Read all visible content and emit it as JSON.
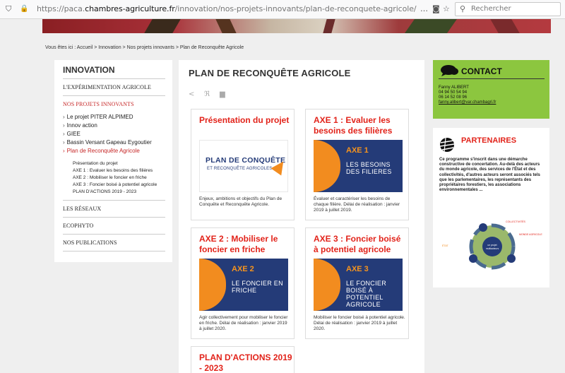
{
  "browser": {
    "url_prefix": "https://paca.",
    "url_domain": "chambres-agriculture.fr",
    "url_path": "/innovation/nos-projets-innovants/plan-de-reconquete-agricole/",
    "menu_icon": "…",
    "search_placeholder": "Rechercher"
  },
  "breadcrumb": "Vous êtes ici : Accueil > Innovation > Nos projets innovants > Plan de Reconquête Agricole",
  "sidebar": {
    "title": "INNOVATION",
    "item_experimentation": "L'EXPÉRIMENTATION AGRICOLE",
    "item_projets": "NOS PROJETS INNOVANTS",
    "sub": [
      "Le projet PITER ALPIMED",
      "Innov action",
      "GIEE",
      "Bassin Versant Gapeau Eygoutier",
      "Plan de Reconquête Agricole"
    ],
    "subsub": [
      "Présentation du projet",
      "AXE 1 : Evaluer les besoins des filières",
      "AXE 2 : Mobiliser le foncier en friche",
      "AXE 3 : Foncier boisé à potentiel agricole",
      "PLAN D'ACTIONS 2019 - 2023"
    ],
    "item_reseaux": "LES RÉSEAUX",
    "item_ecophyto": "ECOPHYTO",
    "item_publications": "NOS PUBLICATIONS"
  },
  "main": {
    "title": "PLAN DE RECONQUÊTE AGRICOLE",
    "cards": [
      {
        "title": "Présentation du projet",
        "img_l1": "PLAN DE CONQUÊTE",
        "img_l2": "ET RECONQUÊTE AGRICOLES",
        "desc": "Enjeux, ambitions et objectifs du Plan de Conquête et Reconquête Agricole."
      },
      {
        "title": "AXE 1 : Evaluer les besoins des filières",
        "img_axe": "AXE 1",
        "img_sub": "LES BESOINS DES FILIERES",
        "desc": "Évaluer et caractériser les besoins de chaque filière. Délai de réalisation : janvier 2019 à juillet 2019."
      },
      {
        "title": "AXE 2 : Mobiliser le foncier en friche",
        "img_axe": "AXE 2",
        "img_sub": "LE FONCIER EN FRICHE",
        "desc": "Agir collectivement pour mobiliser le foncier en friche. Délai de réalisation : janvier 2019 à juillet 2020."
      },
      {
        "title": "AXE 3 : Foncier boisé à potentiel agricole",
        "img_axe": "AXE 3",
        "img_sub": "LE FONCIER BOISÉ À POTENTIEL AGRICOLE",
        "desc": "Mobiliser le foncier boisé à potentiel agricole. Délai de réalisation : janvier 2019 à juillet 2020."
      },
      {
        "title": "PLAN D'ACTIONS 2019 - 2023"
      }
    ]
  },
  "contact": {
    "title": "CONTACT",
    "name": "Fanny ALIBERT",
    "phone1": "04 94 50 54 94",
    "phone2": "06 14 52 08 96",
    "email": "fanny.alibert@var.chambagri.fr"
  },
  "partners": {
    "title": "PARTENAIRES",
    "text": "Ce programme s'inscrit dans une démarche constructive de concertation. Au-delà des acteurs du monde agricole, des services de l'État et des collectivités, d'autres acteurs seront associés tels que les parlementaires, les représentants des propriétaires forestiers, les associations environnementales ...",
    "diagram": {
      "top": "COLLECTIVITÉS",
      "left": "ÉTAT",
      "right": "MONDE AGRICOLE",
      "center_1": "un projet",
      "center_2": "multiacteurs"
    }
  }
}
